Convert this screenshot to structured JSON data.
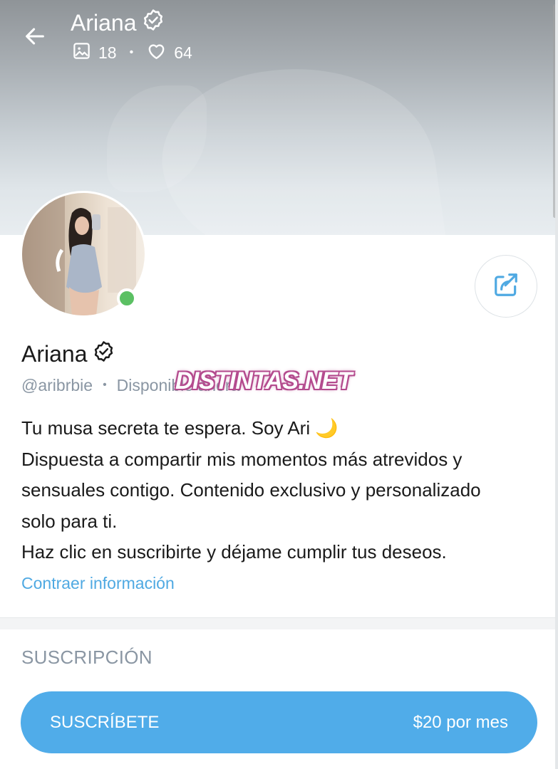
{
  "header": {
    "title": "Ariana",
    "media_count": "18",
    "likes_count": "64",
    "separator": "•"
  },
  "profile": {
    "name": "Ariana",
    "username": "@aribrbie",
    "separator": "•",
    "availability": "Disponible ahora",
    "online": true
  },
  "watermark": "DISTINTAS.NET",
  "bio": {
    "lines": [
      "Tu musa secreta te espera. Soy Ari 🌙",
      "Dispuesta a compartir mis momentos más atrevidos y",
      "sensuales contigo. Contenido exclusivo y personalizado",
      "solo para ti.",
      "Haz clic en suscribirte y déjame cumplir tus deseos."
    ],
    "collapse_label": "Contraer información"
  },
  "subscription": {
    "section_title": "SUSCRIPCIÓN",
    "button_label": "SUSCRÍBETE",
    "price": "$20 por mes"
  },
  "icons": {
    "back": "arrow-left-icon",
    "verified": "verified-badge-icon",
    "media": "image-icon",
    "likes": "heart-icon",
    "share": "share-icon"
  },
  "colors": {
    "accent": "#50ace9",
    "link": "#4fa9e2",
    "online": "#5bc063",
    "muted_text": "#8a96a3"
  }
}
